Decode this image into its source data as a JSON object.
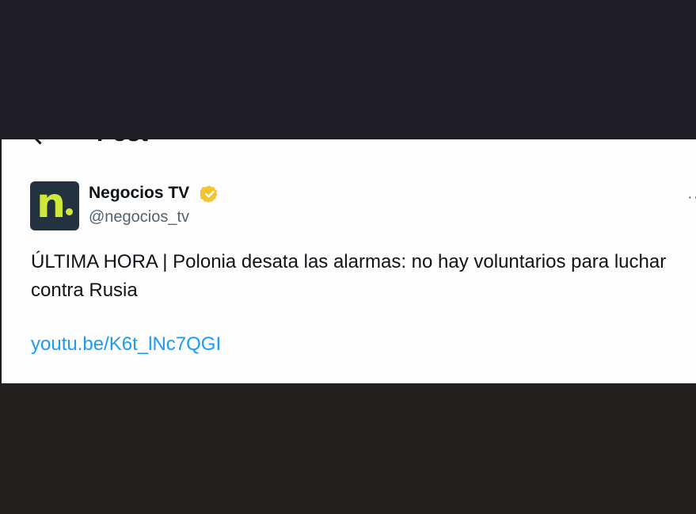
{
  "header": {
    "title": "Post"
  },
  "post": {
    "author": {
      "display_name": "Negocios TV",
      "handle": "@negocios_tv",
      "avatar_letter": "n",
      "verified": true,
      "verified_color": "#f4c430"
    },
    "more_label": "··",
    "text": "ÚLTIMA HORA | Polonia desata las alarmas: no hay voluntarios para luchar contra Rusia",
    "link": "youtu.be/K6t_lNc7QGI"
  },
  "colors": {
    "link": "#1d9bf0",
    "avatar_bg": "#243240",
    "avatar_accent": "#cfe83a"
  }
}
